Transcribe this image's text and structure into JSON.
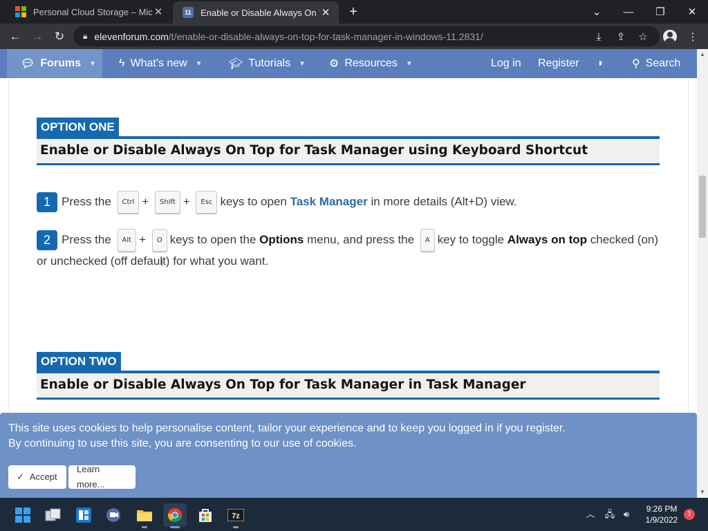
{
  "browser": {
    "tabs": [
      {
        "title": "Personal Cloud Storage – Micros",
        "icon": "microsoft-icon",
        "active": false
      },
      {
        "title": "Enable or Disable Always On Top",
        "icon": "elevenforum-icon",
        "active": true
      }
    ],
    "url_host": "elevenforum.com",
    "url_path": "/t/enable-or-disable-always-on-top-for-task-manager-in-windows-11.2831/"
  },
  "sitenav": {
    "forums": "Forums",
    "whats_new": "What's new",
    "tutorials": "Tutorials",
    "resources": "Resources",
    "login": "Log in",
    "register": "Register",
    "search": "Search"
  },
  "option_one": {
    "tag": "OPTION ONE",
    "heading": "Enable or Disable Always On Top for Task Manager using Keyboard Shortcut",
    "step1": {
      "number": "1",
      "pre": "Press the",
      "key1": "Ctrl",
      "key2": "Shift",
      "key3": "Esc",
      "plus": "+",
      "mid": "keys to open",
      "link": "Task Manager",
      "post": "in more details (Alt+D) view."
    },
    "step2": {
      "number": "2",
      "pre": "Press the",
      "key1": "Alt",
      "key2": "O",
      "plus": "+",
      "mid1": "keys to open the",
      "bold1": "Options",
      "mid2": "menu, and press the",
      "key3": "A",
      "mid3": "key to toggle",
      "bold2": "Always on top",
      "post": "checked (on) or unchecked (off default) for what you want."
    }
  },
  "option_two": {
    "tag": "OPTION TWO",
    "heading": "Enable or Disable Always On Top for Task Manager in Task Manager"
  },
  "cookie": {
    "line1": "This site uses cookies to help personalise content, tailor your experience and to keep you logged in if you register.",
    "line2": "By continuing to use this site, you are consenting to our use of cookies.",
    "accept": "Accept",
    "learn_more": "Learn more..."
  },
  "taskbar": {
    "time": "9:26 PM",
    "date": "1/9/2022",
    "notifications": "1"
  }
}
